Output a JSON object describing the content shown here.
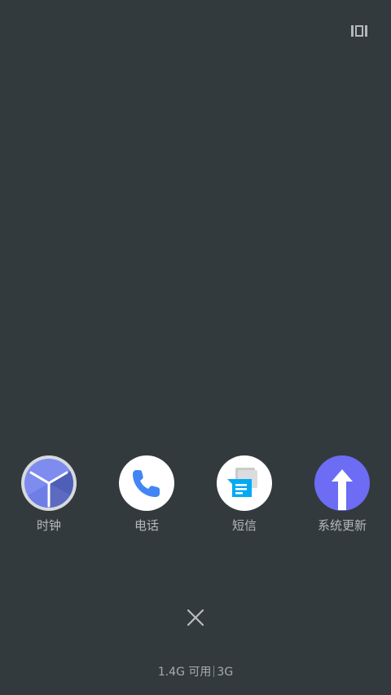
{
  "header": {
    "layout_toggle_icon": "multi-window-icon"
  },
  "apps": [
    {
      "label": "时钟",
      "icon": "clock-icon",
      "color": "#7e8cf0"
    },
    {
      "label": "电话",
      "icon": "phone-icon",
      "color": "#4285f4"
    },
    {
      "label": "短信",
      "icon": "messages-icon",
      "color": "#03a9f4"
    },
    {
      "label": "系统更新",
      "icon": "system-update-icon",
      "color": "#6c6cf4"
    }
  ],
  "footer": {
    "close_icon": "close-icon",
    "memory_available": "1.4G 可用",
    "network": "3G"
  }
}
